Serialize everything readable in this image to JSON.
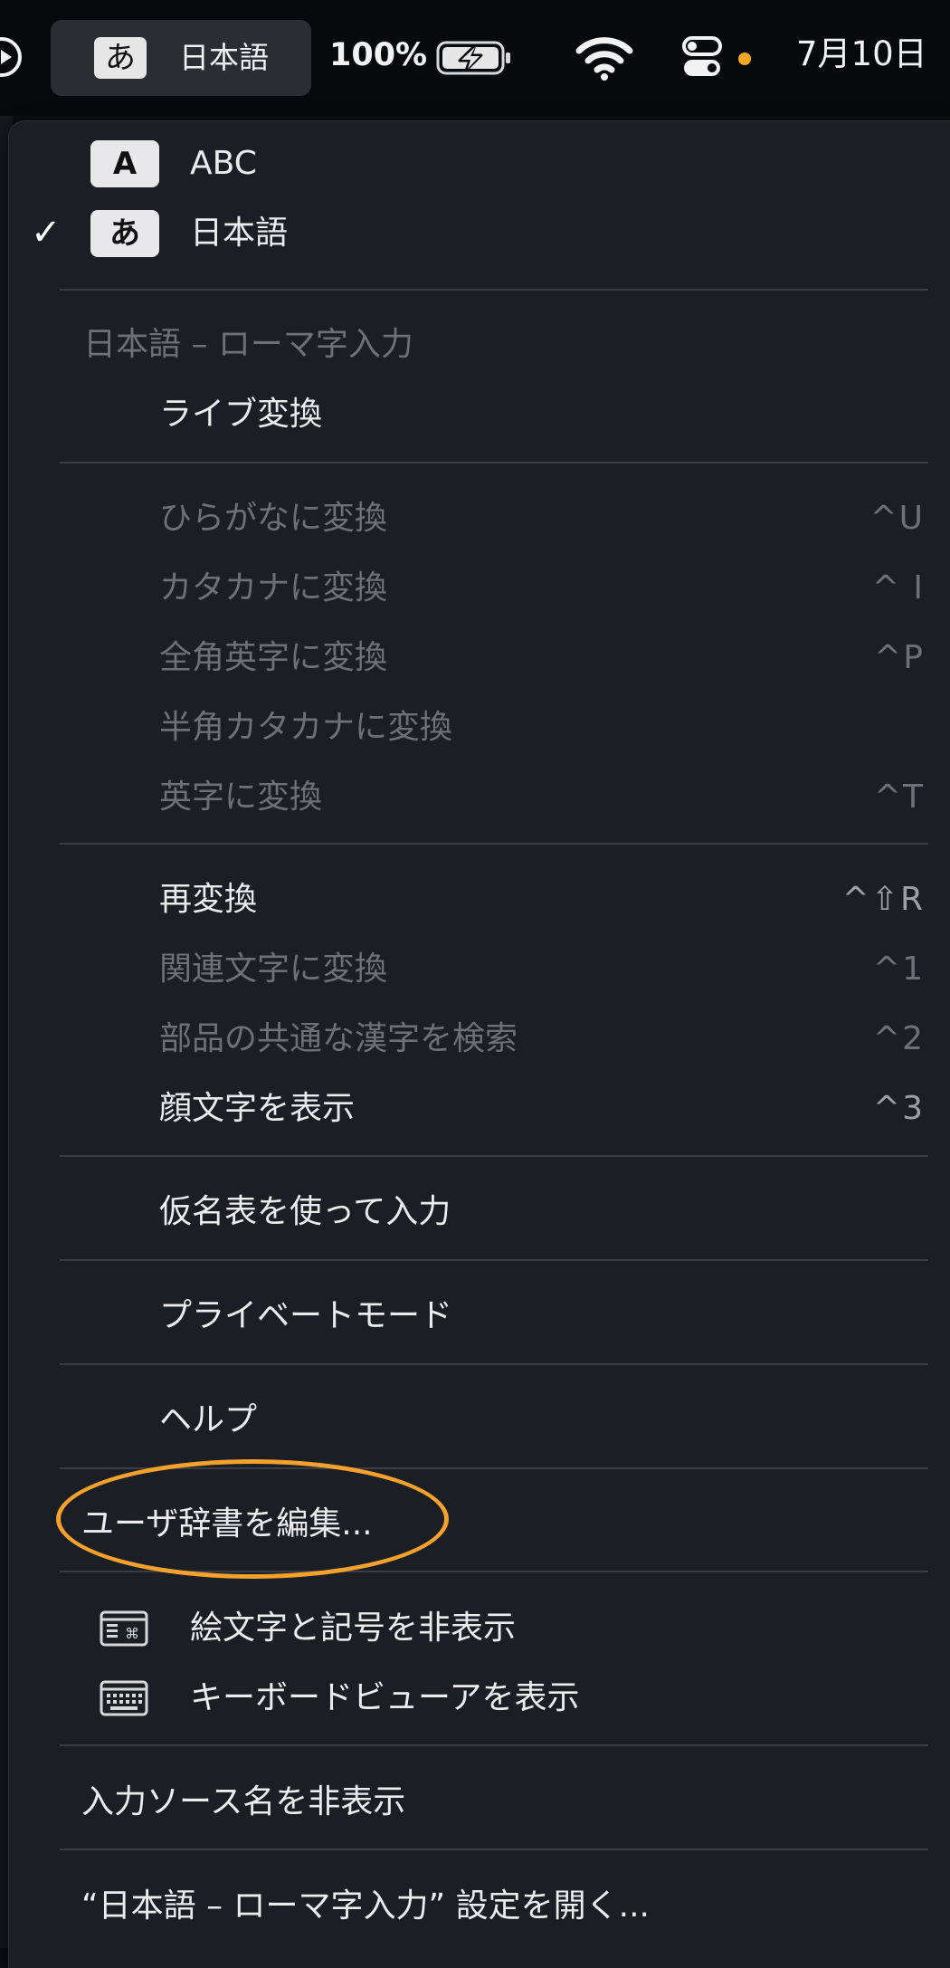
{
  "menubar": {
    "input_badge": "あ",
    "input_label": "日本語",
    "battery_percent": "100%",
    "clock": "7月10日",
    "icons": [
      "play-circle-icon",
      "battery-charging-icon",
      "wifi-icon",
      "control-center-icon"
    ],
    "accent_dot_color": "#f5a623"
  },
  "menu": {
    "sources": [
      {
        "badge": "A",
        "label": "ABC",
        "checked": false
      },
      {
        "badge": "あ",
        "label": "日本語",
        "checked": true
      }
    ],
    "check_mark": "✓",
    "mode_section_label": "日本語 – ローマ字入力",
    "live_conversion": "ライブ変換",
    "convert_items": [
      {
        "label": "ひらがなに変換",
        "shortcut": "^U",
        "enabled": false
      },
      {
        "label": "カタカナに変換",
        "shortcut": "^ I",
        "enabled": false
      },
      {
        "label": "全角英字に変換",
        "shortcut": "^P",
        "enabled": false
      },
      {
        "label": "半角カタカナに変換",
        "shortcut": "",
        "enabled": false
      },
      {
        "label": "英字に変換",
        "shortcut": "^T",
        "enabled": false
      }
    ],
    "reconvert_items": [
      {
        "label": "再変換",
        "shortcut": "^⇧R",
        "enabled": true
      },
      {
        "label": "関連文字に変換",
        "shortcut": "^1",
        "enabled": false
      },
      {
        "label": "部品の共通な漢字を検索",
        "shortcut": "^2",
        "enabled": false
      },
      {
        "label": "顔文字を表示",
        "shortcut": "^3",
        "enabled": true
      }
    ],
    "kana_table": "仮名表を使って入力",
    "private_mode": "プライベートモード",
    "help": "ヘルプ",
    "edit_user_dictionary": "ユーザ辞書を編集...",
    "hide_emoji": "絵文字と記号を非表示",
    "show_keyboard_viewer": "キーボードビューアを表示",
    "hide_input_source_name": "入力ソース名を非表示",
    "open_settings": "“日本語 – ローマ字入力” 設定を開く..."
  },
  "colors": {
    "menu_background": "#1b1f25",
    "highlight_ellipse": "#f5a12c",
    "disabled_text": "#6c7077"
  }
}
